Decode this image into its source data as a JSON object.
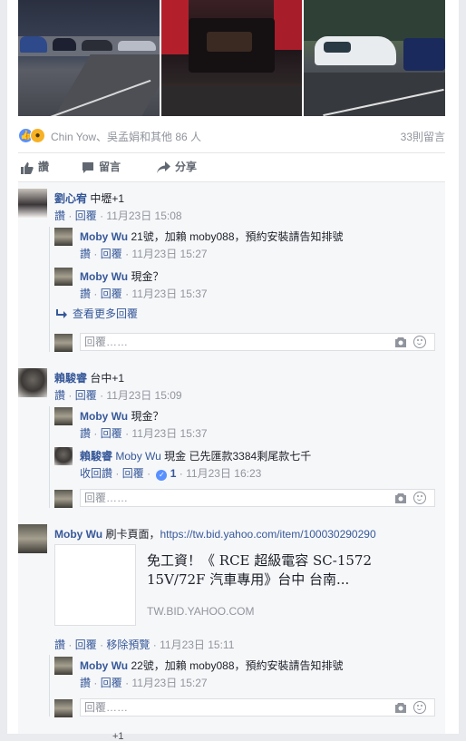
{
  "reactions": {
    "names": "Chin Yow、吳孟娟和其他 86 人",
    "comments_count": "33則留言"
  },
  "actions": {
    "like": "讚",
    "comment": "留言",
    "share": "分享"
  },
  "labels": {
    "like": "讚",
    "reply": "回覆",
    "unlike": "收回讚",
    "remove_preview": "移除預覽",
    "sep": "·",
    "reply_placeholder": "回覆……",
    "view_more": "查看更多回覆"
  },
  "comments": [
    {
      "author": "劉心宥",
      "text": "中壢+1",
      "time": "11月23日 15:08",
      "replies": [
        {
          "author": "Moby Wu",
          "text": "21號，加賴 moby088，預約安裝請告知排號",
          "time": "11月23日 15:27"
        },
        {
          "author": "Moby Wu",
          "text": "現金？",
          "time": "11月23日 15:37"
        }
      ]
    },
    {
      "author": "賴駿睿",
      "text": "台中+1",
      "time": "11月23日 15:09",
      "replies": [
        {
          "author": "Moby Wu",
          "text": "現金？",
          "time": "11月23日 15:37"
        },
        {
          "author": "賴駿睿",
          "mention": "Moby Wu",
          "text": "現金 已先匯款3384剩尾款七千",
          "time": "11月23日 16:23",
          "likes": "1"
        }
      ]
    },
    {
      "author": "Moby Wu",
      "text": "刷卡頁面，",
      "url": "https://tw.bid.yahoo.com/item/100030290290",
      "time": "11月23日 15:11",
      "preview": {
        "title_line1": "免工資！《 RCE 超級電容 SC-1572",
        "title_line2": "15V/72F 汽車專用》台中 台南...",
        "domain": "TW.BID.YAHOO.COM"
      },
      "replies": [
        {
          "author": "Moby Wu",
          "text": "22號，加賴 moby088，預約安裝請告知排號",
          "time": "11月23日 15:27"
        }
      ]
    }
  ],
  "bottom_fragment": "+1",
  "colors": {
    "link": "#365899",
    "meta": "#90949c",
    "like_blue": "#5890ff",
    "wow_yellow": "#f7b125"
  }
}
